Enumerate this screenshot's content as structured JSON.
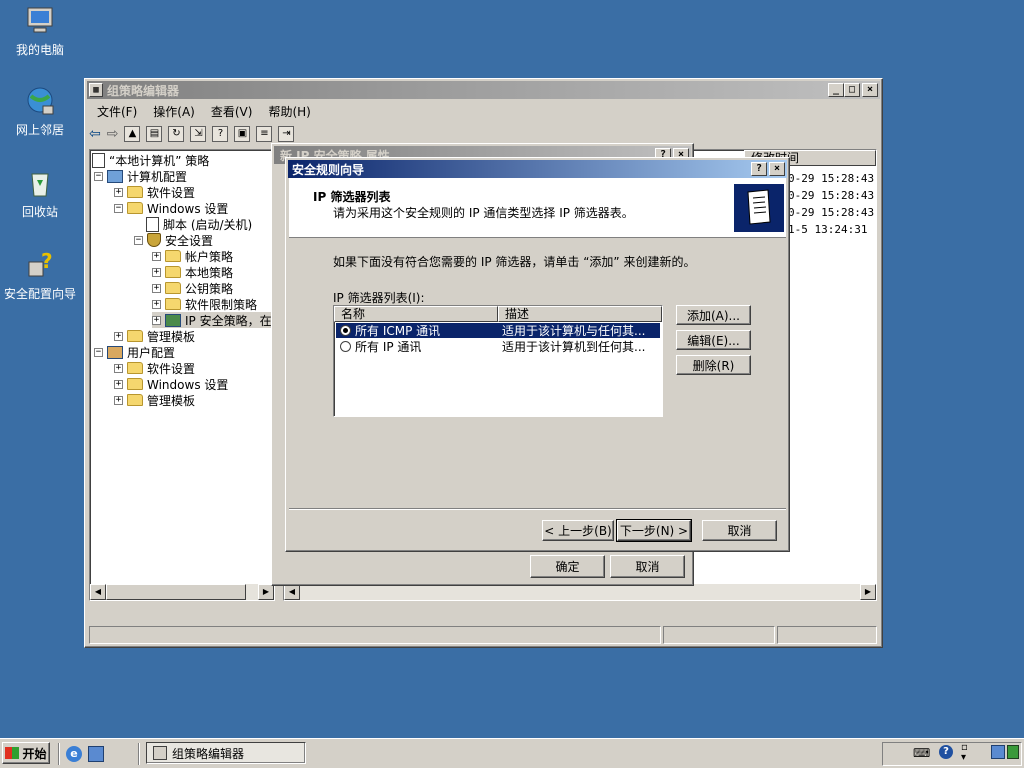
{
  "desktop": {
    "icons": [
      {
        "label": "我的电脑"
      },
      {
        "label": "网上邻居"
      },
      {
        "label": "回收站"
      },
      {
        "label": "安全配置向导"
      }
    ]
  },
  "gpedit": {
    "title": "组策略编辑器",
    "menu": [
      "文件(F)",
      "操作(A)",
      "查看(V)",
      "帮助(H)"
    ],
    "tree": {
      "root": "“本地计算机” 策略",
      "computer": "计算机配置",
      "software_settings": "软件设置",
      "windows_settings": "Windows 设置",
      "scripts": "脚本 (启动/关机)",
      "security_settings": "安全设置",
      "account_policy": "帐户策略",
      "local_policy": "本地策略",
      "pubkey_policy": "公钥策略",
      "software_restriction": "软件限制策略",
      "ip_security": "IP 安全策略，在",
      "admin_templates": "管理模板",
      "user": "用户配置",
      "user_software": "软件设置",
      "user_windows": "Windows 设置",
      "user_admin": "管理模板"
    },
    "right_header": "修改时间",
    "right_rows": [
      "0-29 15:28:43",
      "0-29 15:28:43",
      "0-29 15:28:43",
      "1-5 13:24:31"
    ]
  },
  "props_dialog": {
    "title": "新 IP 安全策略 属性",
    "ok": "确定",
    "cancel": "取消"
  },
  "wizard": {
    "title": "安全规则向导",
    "heading": "IP 筛选器列表",
    "subheading": "请为采用这个安全规则的 IP 通信类型选择 IP 筛选器表。",
    "instruction": "如果下面没有符合您需要的 IP 筛选器，请单击 “添加” 来创建新的。",
    "list_label": "IP 筛选器列表(I):",
    "col_name": "名称",
    "col_desc": "描述",
    "rows": [
      {
        "name": "所有 ICMP 通讯",
        "desc": "适用于该计算机与任何其..."
      },
      {
        "name": "所有 IP 通讯",
        "desc": "适用于该计算机到任何其..."
      }
    ],
    "add": "添加(A)...",
    "edit": "编辑(E)...",
    "remove": "删除(R)",
    "back": "< 上一步(B)",
    "next": "下一步(N) >",
    "cancel": "取消"
  },
  "taskbar": {
    "start": "开始",
    "task": "组策略编辑器"
  },
  "colors": {
    "desktop": "#3a6ea5",
    "titlebar": "#0a246a",
    "selection": "#0a246a"
  }
}
